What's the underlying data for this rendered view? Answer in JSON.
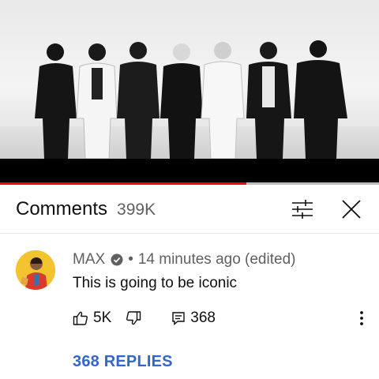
{
  "video": {
    "progress_fraction": 0.65,
    "progress_color": "#ff0000"
  },
  "comments_panel": {
    "title": "Comments",
    "count": "399K",
    "filter_icon": "filter-sliders-icon",
    "close_icon": "close-icon"
  },
  "comment": {
    "author": "MAX",
    "verified_icon": "verified-check-icon",
    "separator": "•",
    "time": "14 minutes ago (edited)",
    "text": "This is going to be iconic",
    "likes": "5K",
    "replies_count": "368",
    "replies_link": "368 REPLIES",
    "link_color": "#3366cc"
  }
}
